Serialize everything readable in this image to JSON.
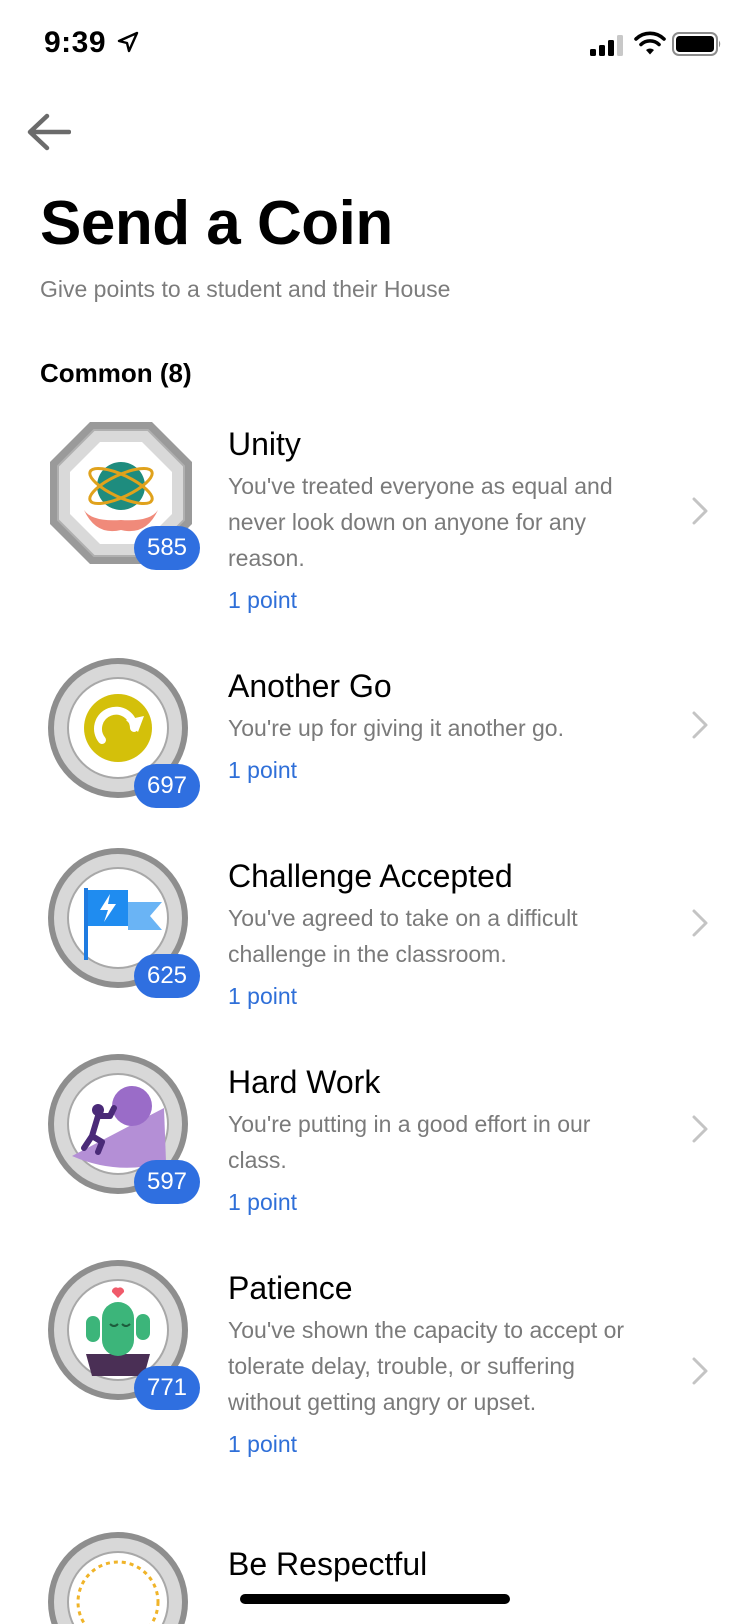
{
  "status_bar": {
    "time": "9:39"
  },
  "header": {
    "title": "Send a Coin",
    "subtitle": "Give points to a student and their House"
  },
  "section": {
    "title": "Common (8)"
  },
  "coins": [
    {
      "name": "Unity",
      "description": "You've treated everyone as equal and never look down on anyone for any reason.",
      "points": "1 point",
      "count": "585",
      "badge_icon": "globe-hands-icon"
    },
    {
      "name": "Another Go",
      "description": "You're up for giving it another go.",
      "points": "1 point",
      "count": "697",
      "badge_icon": "redo-arrow-icon"
    },
    {
      "name": "Challenge Accepted",
      "description": "You've agreed to take on a difficult challenge in the classroom.",
      "points": "1 point",
      "count": "625",
      "badge_icon": "lightning-flag-icon"
    },
    {
      "name": "Hard Work",
      "description": "You're putting in a good effort in our class.",
      "points": "1 point",
      "count": "597",
      "badge_icon": "pushing-boulder-icon"
    },
    {
      "name": "Patience",
      "description": "You've shown the capacity to accept or tolerate delay, trouble, or suffering without getting angry or upset.",
      "points": "1 point",
      "count": "771",
      "badge_icon": "cactus-icon"
    },
    {
      "name": "Be Respectful",
      "description": "",
      "points": "",
      "count": "",
      "badge_icon": "coin-icon"
    }
  ],
  "colors": {
    "accent": "#2f6fe0",
    "subtext": "#7a7a7a"
  }
}
